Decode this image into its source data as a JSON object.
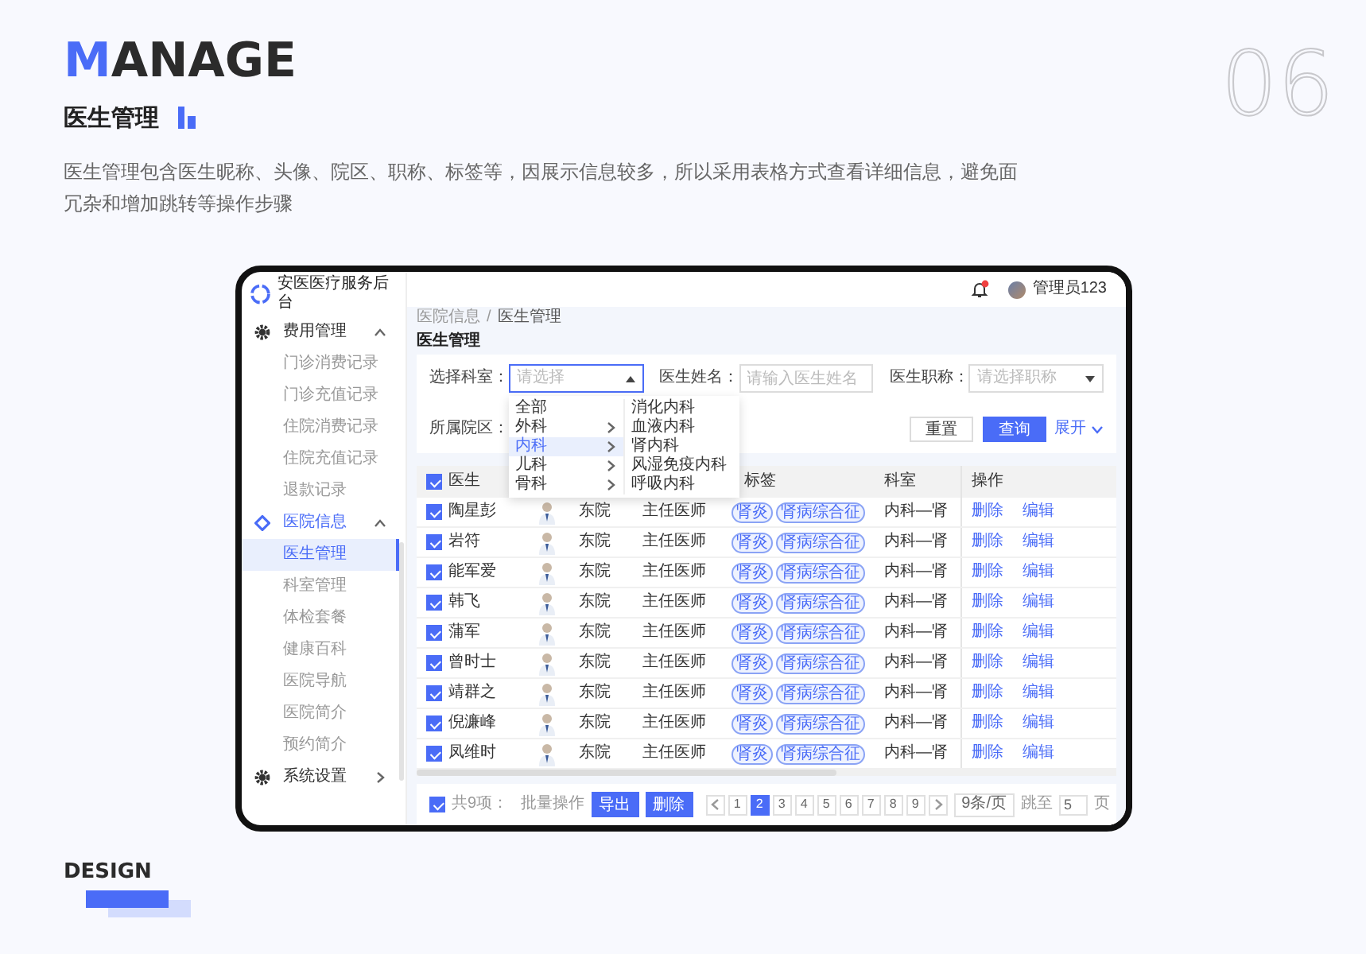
{
  "slide": {
    "title_accent": "M",
    "title_rest": "ANAGE",
    "number": "06",
    "subtitle": "医生管理",
    "description": "医生管理包含医生昵称、头像、院区、职称、标签等，因展示信息较多，所以采用表格方式查看详细信息，避免面冗杂和增加跳转等操作步骤",
    "footer": "DESIGN"
  },
  "app": {
    "brand": "安医医疗服务后台",
    "user": "管理员123",
    "sidebar": [
      {
        "label": "费用管理",
        "active": false,
        "expanded": true,
        "children": [
          {
            "label": "门诊消费记录",
            "selected": false
          },
          {
            "label": "门诊充值记录",
            "selected": false
          },
          {
            "label": "住院消费记录",
            "selected": false
          },
          {
            "label": "住院充值记录",
            "selected": false
          },
          {
            "label": "退款记录",
            "selected": false
          }
        ]
      },
      {
        "label": "医院信息",
        "active": true,
        "expanded": true,
        "children": [
          {
            "label": "医生管理",
            "selected": true
          },
          {
            "label": "科室管理",
            "selected": false
          },
          {
            "label": "体检套餐",
            "selected": false
          },
          {
            "label": "健康百科",
            "selected": false
          },
          {
            "label": "医院导航",
            "selected": false
          },
          {
            "label": "医院简介",
            "selected": false
          },
          {
            "label": "预约简介",
            "selected": false
          }
        ]
      },
      {
        "label": "系统设置",
        "active": false,
        "expanded": false
      }
    ],
    "breadcrumb": {
      "parent": "医院信息",
      "separator": "/",
      "current": "医生管理"
    },
    "page_title": "医生管理",
    "filters": [
      {
        "label": "选择科室：",
        "kind": "select",
        "placeholder": "请选择",
        "open": true
      },
      {
        "label": "医生姓名：",
        "kind": "input",
        "placeholder": "请输入医生姓名"
      },
      {
        "label": "医生职称：",
        "kind": "select",
        "placeholder": "请选择职称",
        "open": false
      }
    ],
    "campus_label": "所属院区：",
    "buttons": [
      {
        "label": "重置",
        "primary": false
      },
      {
        "label": "查询",
        "primary": true
      }
    ],
    "expand_link": "展开",
    "cascader": {
      "level1": [
        {
          "label": "全部",
          "has_children": false,
          "selected": false
        },
        {
          "label": "外科",
          "has_children": true,
          "selected": false
        },
        {
          "label": "内科",
          "has_children": true,
          "selected": true
        },
        {
          "label": "儿科",
          "has_children": true,
          "selected": false
        },
        {
          "label": "骨科",
          "has_children": true,
          "selected": false
        }
      ],
      "level2": [
        "消化内科",
        "血液内科",
        "肾内科",
        "风湿免疫内科",
        "呼吸内科"
      ]
    },
    "table": {
      "header_checked": true,
      "columns": [
        {
          "label": "医生"
        },
        {
          "label": "标签"
        },
        {
          "label": "科室"
        },
        {
          "label": "操作"
        }
      ],
      "rows": [
        {
          "checked": true,
          "name": "陶星彭",
          "campus": "东院",
          "title": "主任医师",
          "tags": [
            "肾炎",
            "肾病综合征"
          ],
          "department": "内科—肾",
          "actions": [
            "删除",
            "编辑"
          ]
        },
        {
          "checked": true,
          "name": "岩符",
          "campus": "东院",
          "title": "主任医师",
          "tags": [
            "肾炎",
            "肾病综合征"
          ],
          "department": "内科—肾",
          "actions": [
            "删除",
            "编辑"
          ]
        },
        {
          "checked": true,
          "name": "能军爱",
          "campus": "东院",
          "title": "主任医师",
          "tags": [
            "肾炎",
            "肾病综合征"
          ],
          "department": "内科—肾",
          "actions": [
            "删除",
            "编辑"
          ]
        },
        {
          "checked": true,
          "name": "韩飞",
          "campus": "东院",
          "title": "主任医师",
          "tags": [
            "肾炎",
            "肾病综合征"
          ],
          "department": "内科—肾",
          "actions": [
            "删除",
            "编辑"
          ]
        },
        {
          "checked": true,
          "name": "蒲军",
          "campus": "东院",
          "title": "主任医师",
          "tags": [
            "肾炎",
            "肾病综合征"
          ],
          "department": "内科—肾",
          "actions": [
            "删除",
            "编辑"
          ]
        },
        {
          "checked": true,
          "name": "曾时士",
          "campus": "东院",
          "title": "主任医师",
          "tags": [
            "肾炎",
            "肾病综合征"
          ],
          "department": "内科—肾",
          "actions": [
            "删除",
            "编辑"
          ]
        },
        {
          "checked": true,
          "name": "靖群之",
          "campus": "东院",
          "title": "主任医师",
          "tags": [
            "肾炎",
            "肾病综合征"
          ],
          "department": "内科—肾",
          "actions": [
            "删除",
            "编辑"
          ]
        },
        {
          "checked": true,
          "name": "倪濂峰",
          "campus": "东院",
          "title": "主任医师",
          "tags": [
            "肾炎",
            "肾病综合征"
          ],
          "department": "内科—肾",
          "actions": [
            "删除",
            "编辑"
          ]
        },
        {
          "checked": true,
          "name": "凤维时",
          "campus": "东院",
          "title": "主任医师",
          "tags": [
            "肾炎",
            "肾病综合征"
          ],
          "department": "内科—肾",
          "actions": [
            "删除",
            "编辑"
          ]
        }
      ]
    },
    "footer": {
      "select_all": true,
      "total": "共9项：",
      "batch_label": "批量操作",
      "batch_buttons": [
        "导出",
        "删除"
      ],
      "pages": [
        {
          "label": "1",
          "selected": false
        },
        {
          "label": "2",
          "selected": true
        },
        {
          "label": "3",
          "selected": false
        },
        {
          "label": "4",
          "selected": false
        },
        {
          "label": "5",
          "selected": false
        },
        {
          "label": "6",
          "selected": false
        },
        {
          "label": "7",
          "selected": false
        },
        {
          "label": "8",
          "selected": false
        },
        {
          "label": "9",
          "selected": false
        }
      ],
      "page_size": "9条/页",
      "jump_label": "跳至",
      "jump_value": "5",
      "page_suffix": "页"
    }
  }
}
